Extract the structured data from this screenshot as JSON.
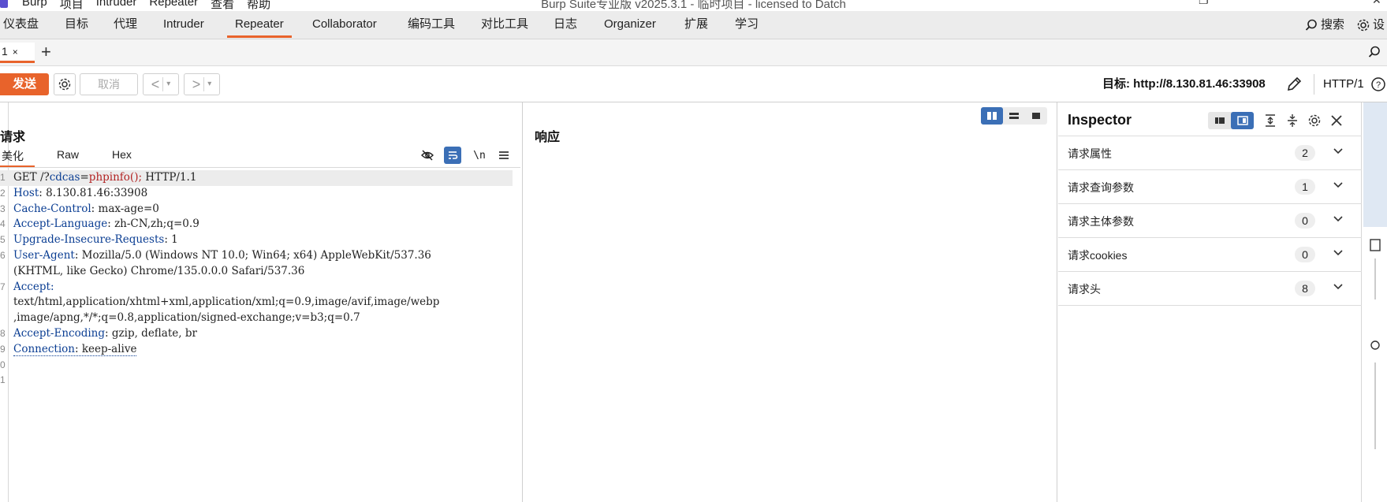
{
  "titlebar": {
    "menu": [
      "Burp",
      "项目",
      "Intruder",
      "Repeater",
      "查看",
      "帮助"
    ],
    "title": "Burp Suite专业版  v2025.3.1 - 临时项目 - licensed to Datch"
  },
  "main_tabs": [
    "仪表盘",
    "目标",
    "代理",
    "Intruder",
    "Repeater",
    "Collaborator",
    "编码工具",
    "对比工具",
    "日志",
    "Organizer",
    "扩展",
    "学习"
  ],
  "main_tabs_active": "Repeater",
  "search_label": "搜索",
  "settings_label": "设",
  "sub_tab": {
    "label": "1",
    "close": "×",
    "add": "+"
  },
  "toolbar": {
    "send_label": "发送",
    "cancel_label": "取消",
    "back_symbol": "<",
    "forward_symbol": ">",
    "dropdown_symbol": "▾",
    "target_text": "目标: http://8.130.81.46:33908",
    "http_version": "HTTP/1"
  },
  "request": {
    "title": "请求",
    "tabs": [
      "美化",
      "Raw",
      "Hex"
    ],
    "active_tab": "美化",
    "newline_tool": "\\n",
    "line_numbers": [
      "1",
      "2",
      "3",
      "4",
      "5",
      "6",
      "",
      "7",
      "",
      "",
      "8",
      "9",
      "0",
      "1"
    ],
    "line1": {
      "method": "GET ",
      "path1": "/?",
      "param": "cdcas",
      "eq": "=",
      "value": "phpinfo",
      "tail1": "(); ",
      "proto": "HTTP/1.1"
    },
    "headers": [
      {
        "name": "Host",
        "sep": ": ",
        "value": "8.130.81.46:33908"
      },
      {
        "name": "Cache-Control",
        "sep": ": ",
        "value": "max-age=0"
      },
      {
        "name": "Accept-Language",
        "sep": ": ",
        "value": "zh-CN,zh;q=0.9"
      },
      {
        "name": "Upgrade-Insecure-Requests",
        "sep": ": ",
        "value": "1"
      },
      {
        "name": "User-Agent",
        "sep": ": ",
        "value": "Mozilla/5.0 (Windows NT 10.0; Win64; x64) AppleWebKit/537.36"
      },
      {
        "name": "",
        "sep": "",
        "value": "(KHTML, like Gecko) Chrome/135.0.0.0 Safari/537.36"
      },
      {
        "name": "Accept",
        "sep": ":",
        "value": ""
      },
      {
        "name": "",
        "sep": "",
        "value": "text/html,application/xhtml+xml,application/xml;q=0.9,image/avif,image/webp"
      },
      {
        "name": "",
        "sep": "",
        "value": ",image/apng,*/*;q=0.8,application/signed-exchange;v=b3;q=0.7"
      },
      {
        "name": "Accept-Encoding",
        "sep": ": ",
        "value": "gzip, deflate, br"
      },
      {
        "name": "Connection",
        "sep": ": ",
        "value": "keep-alive"
      }
    ]
  },
  "response": {
    "title": "响应"
  },
  "inspector": {
    "title": "Inspector",
    "sections": [
      {
        "label": "请求属性",
        "count": "2"
      },
      {
        "label": "请求查询参数",
        "count": "1"
      },
      {
        "label": "请求主体参数",
        "count": "0"
      },
      {
        "label": "请求cookies",
        "count": "0"
      },
      {
        "label": "请求头",
        "count": "8"
      }
    ]
  },
  "colors": {
    "accent": "#e8632b",
    "selected_toggle": "#3b6fb6",
    "header_key": "#0b3e93",
    "param_value": "#b22222"
  }
}
